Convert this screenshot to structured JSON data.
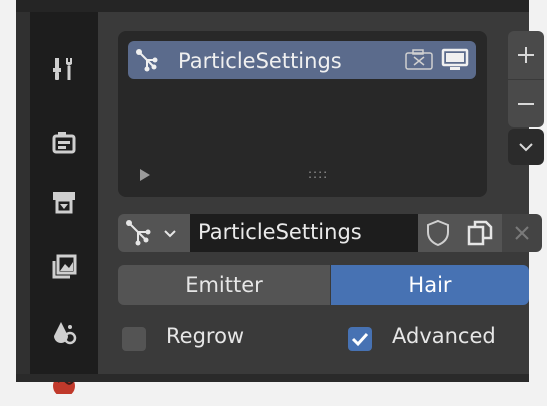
{
  "particle_slots": {
    "items": [
      {
        "label": "ParticleSettings",
        "selected": true
      }
    ]
  },
  "datablock": {
    "name": "ParticleSettings"
  },
  "emission_type": {
    "options": [
      "Emitter",
      "Hair"
    ],
    "selected": "Hair"
  },
  "checkboxes": {
    "regrow": {
      "label": "Regrow",
      "checked": false
    },
    "advanced": {
      "label": "Advanced",
      "checked": true
    }
  },
  "colors": {
    "accent": "#4772b3",
    "selected_row": "#5b6b8c",
    "panel": "#3a3a3a",
    "tab_bar": "#1d1d1d"
  },
  "icons": {
    "list_item": "particles-icon",
    "camera": "camera-icon",
    "monitor": "monitor-icon",
    "add": "plus-icon",
    "remove": "minus-icon",
    "specials": "chevron-down-icon",
    "fake_user": "shield-icon",
    "duplicate": "duplicate-icon",
    "unlink": "close-icon"
  }
}
